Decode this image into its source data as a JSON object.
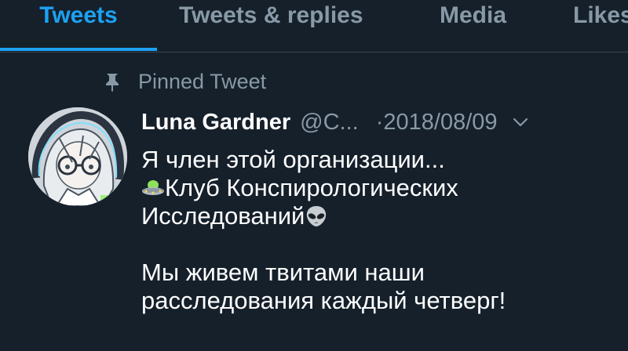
{
  "tabs": [
    {
      "label": "Tweets",
      "active": true
    },
    {
      "label": "Tweets & replies",
      "active": false
    },
    {
      "label": "Media",
      "active": false
    },
    {
      "label": "Likes",
      "active": false
    }
  ],
  "pinned": {
    "label": "Pinned Tweet",
    "icon": "pin-icon"
  },
  "tweet": {
    "author_name": "Luna Gardner",
    "author_handle": "@C...",
    "date": "·2018/08/09",
    "menu_icon": "chevron-down-icon",
    "lines": {
      "line1": "Я член этой организации...",
      "line2": "Клуб Конспирологических",
      "line3": "Исследований",
      "line4": "Мы живем твитами наши",
      "line5": "расследования каждый четверг!"
    },
    "emojis": [
      "flying-saucer-icon",
      "alien-icon"
    ]
  },
  "colors": {
    "background": "#15202b",
    "accent": "#1da1f2",
    "muted": "#8899a6",
    "text": "#ffffff",
    "divider": "#38444d"
  }
}
